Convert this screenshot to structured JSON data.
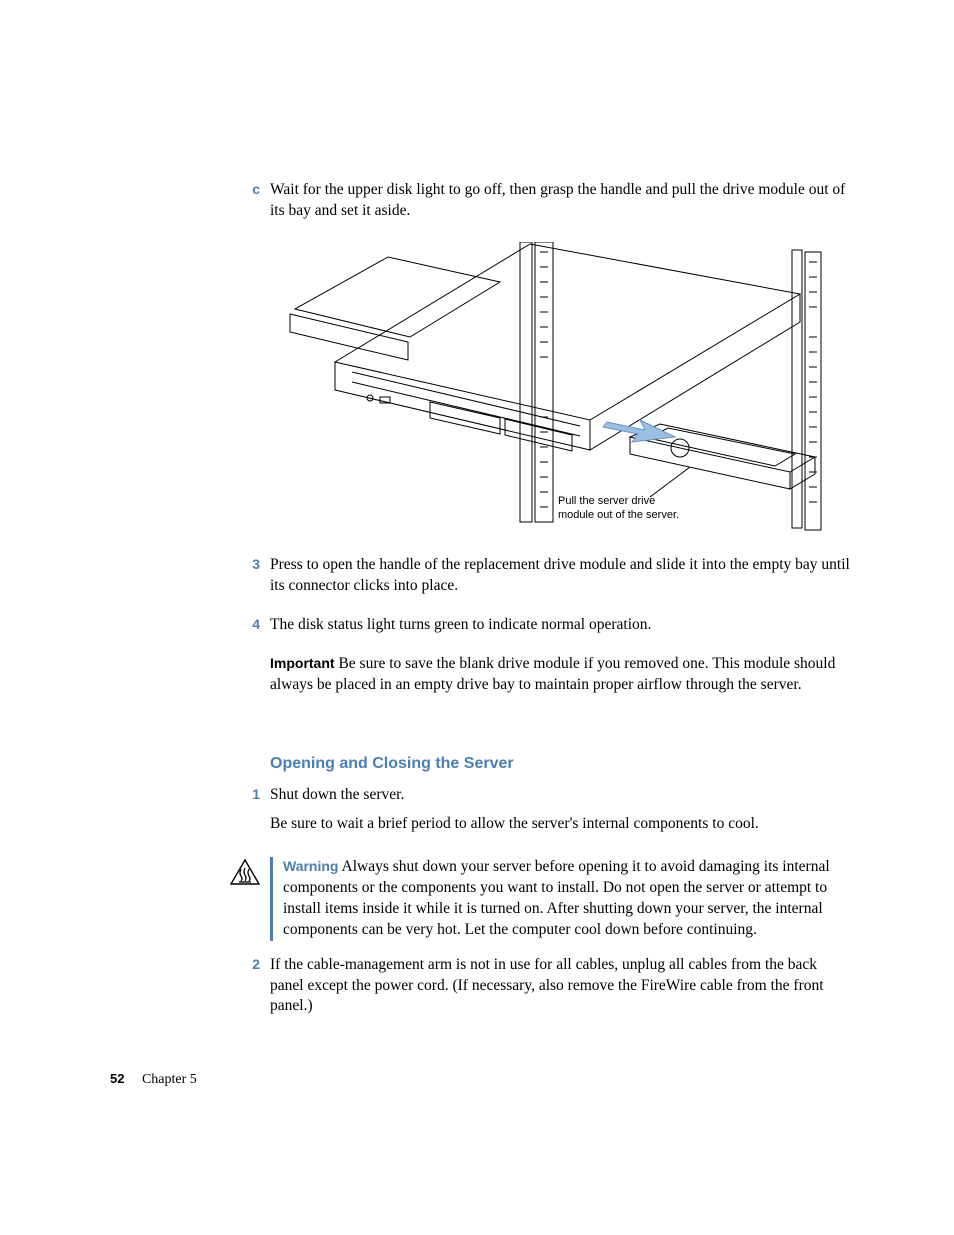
{
  "steps_c": {
    "marker": "c",
    "text": "Wait for the upper disk light to go off, then grasp the handle and pull the drive module out of its bay and set it aside."
  },
  "figure": {
    "caption_line1": "Pull the server drive",
    "caption_line2": "module out of the server."
  },
  "step_3": {
    "marker": "3",
    "text": "Press to open the handle of the replacement drive module and slide it into the empty bay until its connector clicks into place."
  },
  "step_4": {
    "marker": "4",
    "text": "The disk status light turns green to indicate normal operation."
  },
  "important": {
    "label": "Important",
    "text": "  Be sure to save the blank drive module if you removed one. This module should always be placed in an empty drive bay to maintain proper airflow through the server."
  },
  "section_heading": "Opening and Closing the Server",
  "step_s1": {
    "marker": "1",
    "text": "Shut down the server.",
    "text2": "Be sure to wait a brief period to allow the server's internal components to cool."
  },
  "warning": {
    "label": "Warning",
    "text": "  Always shut down your server before opening it to avoid damaging its internal components or the components you want to install. Do not open the server or attempt to install items inside it while it is turned on. After shutting down your server, the internal components can be very hot. Let the computer cool down before continuing."
  },
  "step_s2": {
    "marker": "2",
    "text": "If the cable-management arm is not in use for all cables, unplug all cables from the back panel except the power cord. (If necessary, also remove the FireWire cable from the front panel.)"
  },
  "footer": {
    "page": "52",
    "chapter": "Chapter 5"
  }
}
